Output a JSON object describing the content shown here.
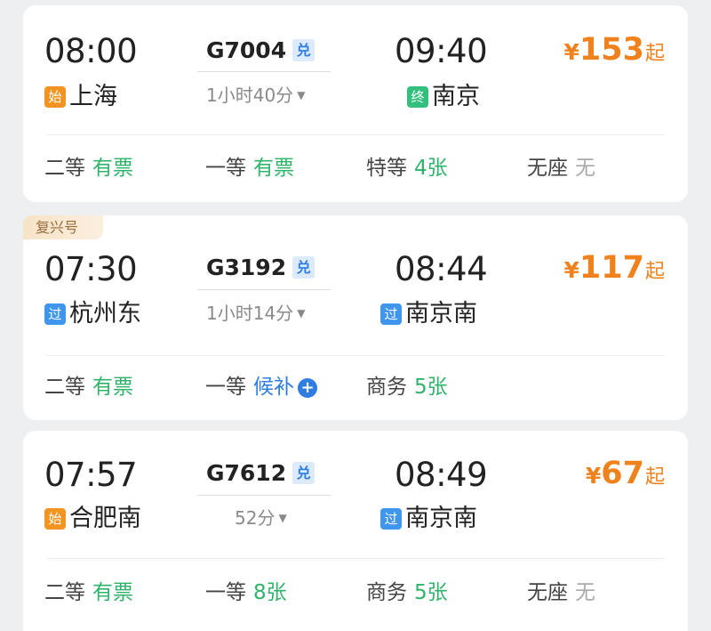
{
  "trains": [
    {
      "tag": "",
      "depart_time": "08:00",
      "depart_badge": "始",
      "depart_station": "上海",
      "train_no": "G7004",
      "dui": "兑",
      "duration": "1小时40分",
      "arrive_time": "09:40",
      "arrive_badge": "终",
      "arrive_station": "南京",
      "price_symbol": "¥",
      "price": "153",
      "price_suffix": "起",
      "seats": [
        {
          "name": "二等",
          "status": "有票"
        },
        {
          "name": "一等",
          "status": "有票"
        },
        {
          "name": "特等",
          "status": "4张"
        },
        {
          "name": "无座",
          "status": "无"
        }
      ]
    },
    {
      "tag": "复兴号",
      "depart_time": "07:30",
      "depart_badge": "过",
      "depart_station": "杭州东",
      "train_no": "G3192",
      "dui": "兑",
      "duration": "1小时14分",
      "arrive_time": "08:44",
      "arrive_badge": "过",
      "arrive_station": "南京南",
      "price_symbol": "¥",
      "price": "117",
      "price_suffix": "起",
      "seats": [
        {
          "name": "二等",
          "status": "有票"
        },
        {
          "name": "一等",
          "status": "候补"
        },
        {
          "name": "商务",
          "status": "5张"
        }
      ]
    },
    {
      "tag": "",
      "depart_time": "07:57",
      "depart_badge": "始",
      "depart_station": "合肥南",
      "train_no": "G7612",
      "dui": "兑",
      "duration": "52分",
      "arrive_time": "08:49",
      "arrive_badge": "过",
      "arrive_station": "南京南",
      "price_symbol": "¥",
      "price": "67",
      "price_suffix": "起",
      "seats": [
        {
          "name": "二等",
          "status": "有票"
        },
        {
          "name": "一等",
          "status": "8张"
        },
        {
          "name": "商务",
          "status": "5张"
        },
        {
          "name": "无座",
          "status": "无"
        }
      ]
    }
  ],
  "colors": {
    "price": "#f0821e",
    "available": "#2fb36a",
    "unavailable": "#aaaaaa",
    "waitlist": "#2f7de1",
    "badge_start": "#f39422",
    "badge_end": "#33c07c",
    "badge_pass": "#3f96ec"
  },
  "icons": {
    "duration_toggle": "chevron-down-icon",
    "waitlist_add": "plus-circle-icon"
  }
}
